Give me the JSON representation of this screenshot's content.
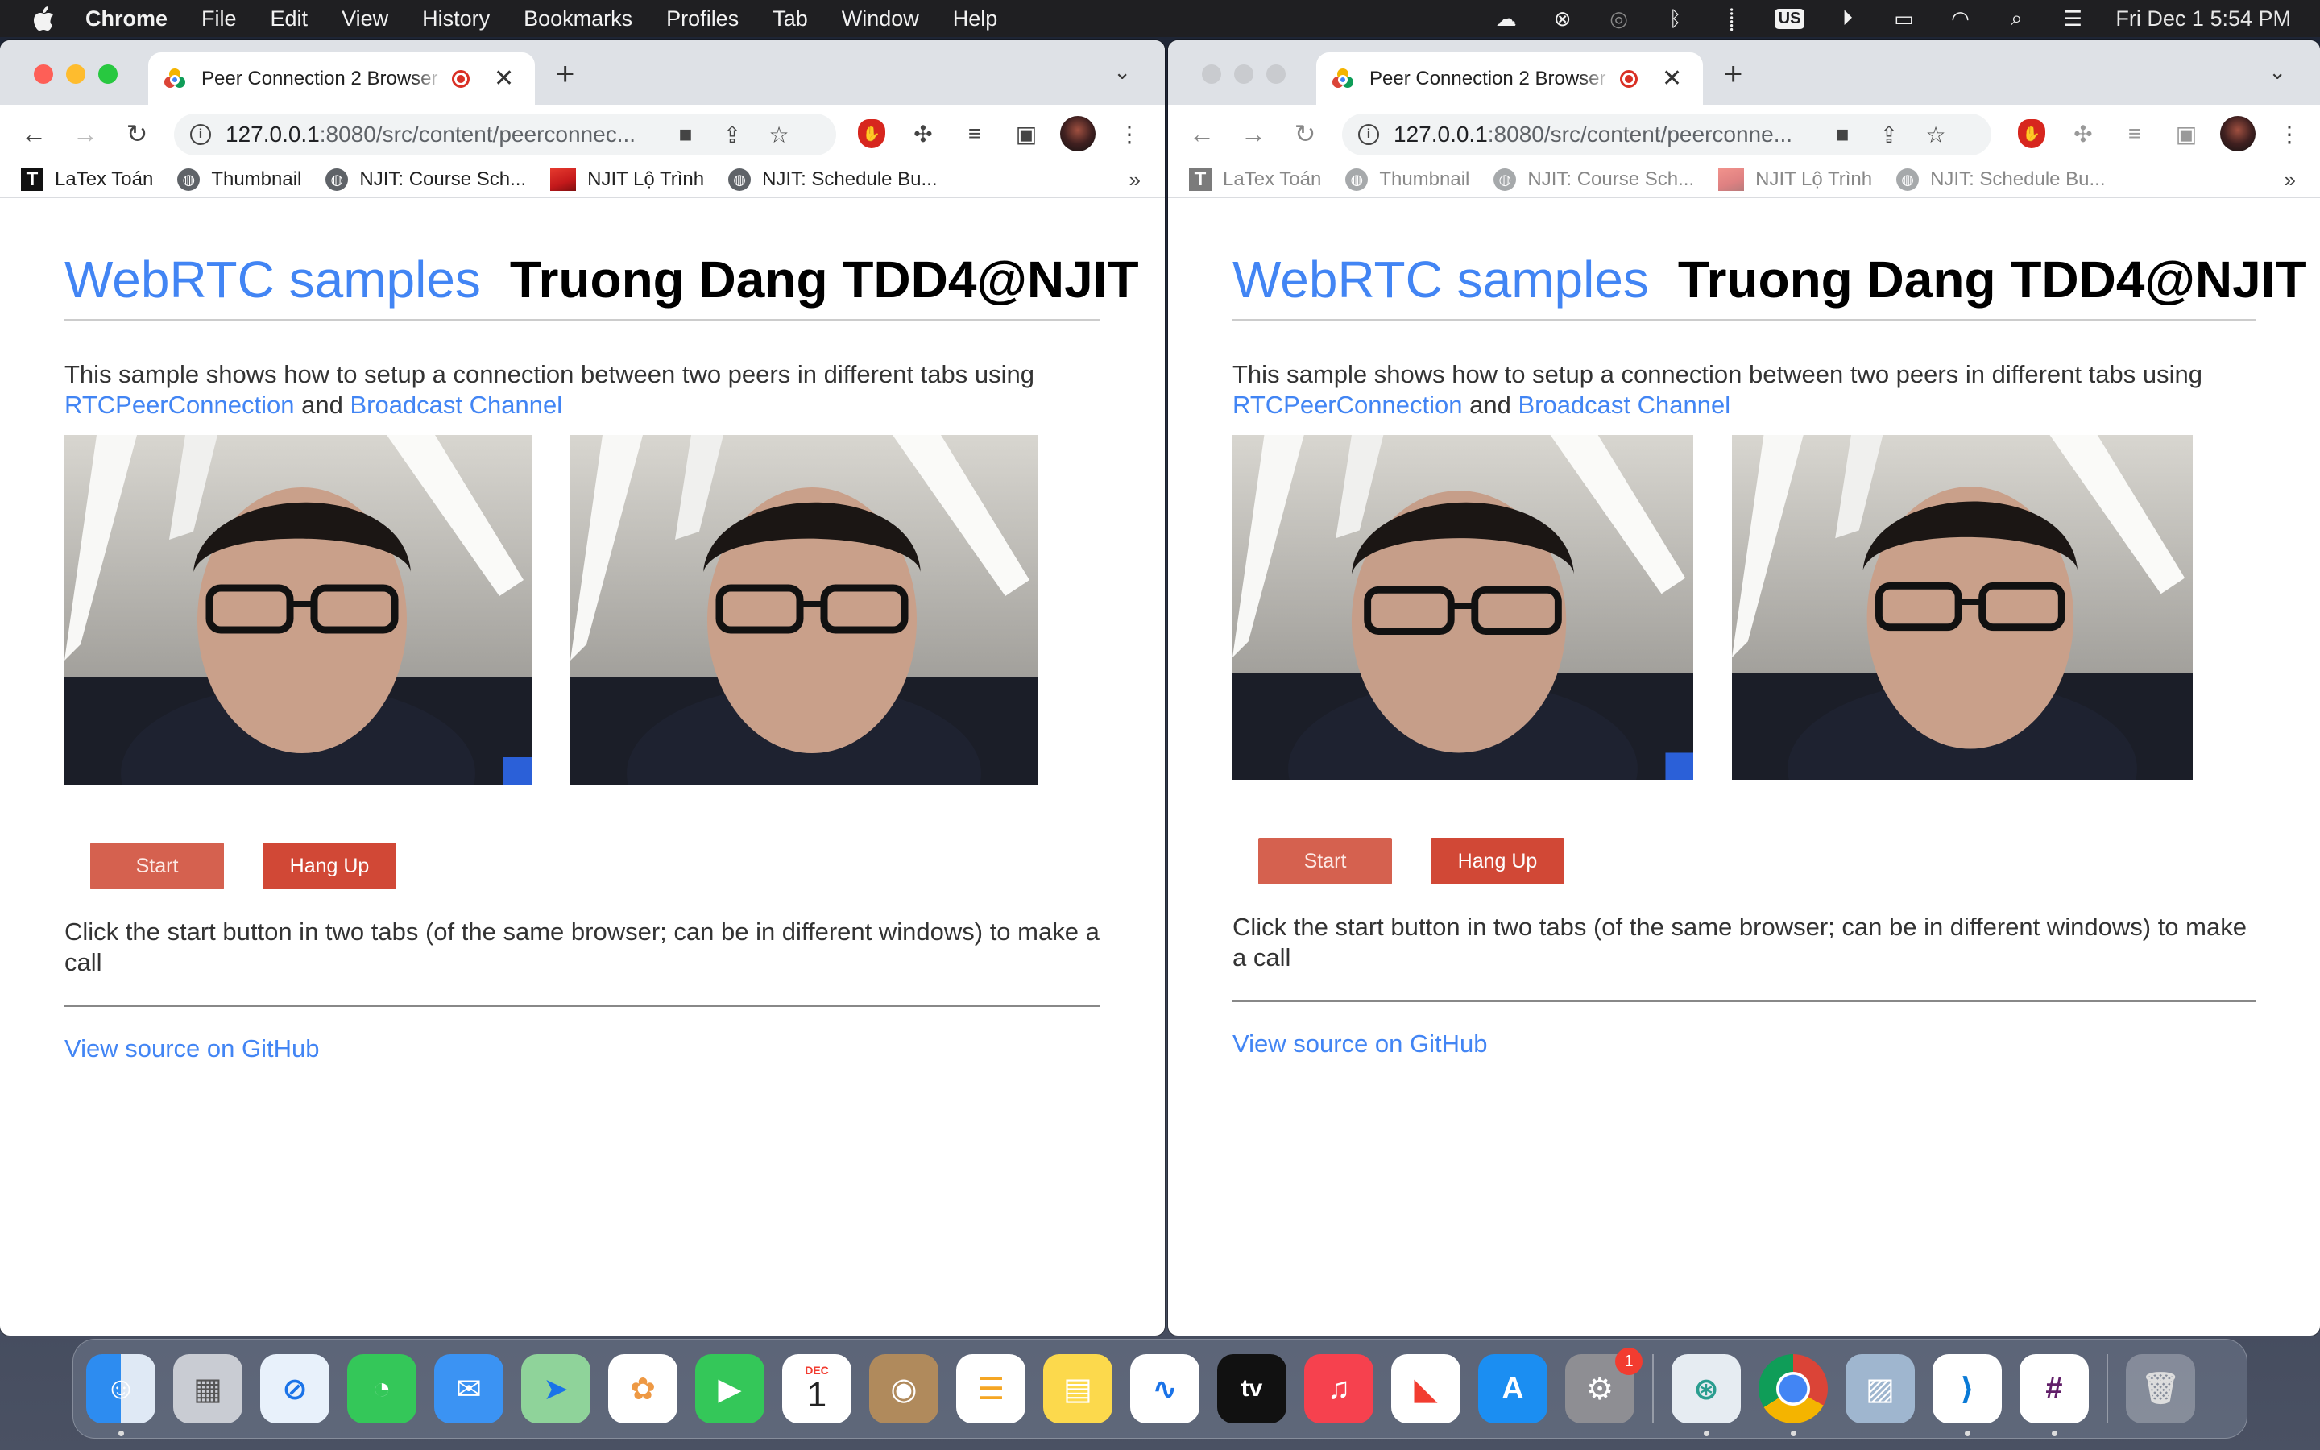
{
  "menubar": {
    "app_name": "Chrome",
    "menus": [
      "File",
      "Edit",
      "View",
      "History",
      "Bookmarks",
      "Profiles",
      "Tab",
      "Window",
      "Help"
    ],
    "status_icons": [
      "creative-cloud-icon",
      "screen-share-icon",
      "airdrop-icon",
      "bluetooth-icon",
      "airpods-icon"
    ],
    "input_source": "US",
    "clock": "Fri Dec 1  5:54 PM"
  },
  "windows": [
    {
      "tab_title": "Peer Connection 2 Browser",
      "url_host": "127.0.0.1",
      "url_rest": ":8080/src/content/peerconnec...",
      "bookmarks": [
        "LaTex Toán",
        "Thumbnail",
        "NJIT: Course Sch...",
        "NJIT Lộ Trình",
        "NJIT: Schedule Bu..."
      ],
      "page": {
        "title_link": "WebRTC samples",
        "title_author": "Truong Dang TDD4@NJIT",
        "description": "This sample shows how to setup a connection between two peers in different tabs using",
        "link1": "RTCPeerConnection",
        "and": "and",
        "link2": "Broadcast Channel",
        "start_label": "Start",
        "hangup_label": "Hang Up",
        "instructions": "Click the start button in two tabs (of the same browser; can be in different windows) to make a call",
        "source_link": "View source on GitHub"
      }
    },
    {
      "tab_title": "Peer Connection 2 Browser",
      "url_host": "127.0.0.1",
      "url_rest": ":8080/src/content/peerconne...",
      "bookmarks": [
        "LaTex Toán",
        "Thumbnail",
        "NJIT: Course Sch...",
        "NJIT Lộ Trình",
        "NJIT: Schedule Bu..."
      ],
      "page": {
        "title_link": "WebRTC samples",
        "title_author": "Truong Dang TDD4@NJIT",
        "description": "This sample shows how to setup a connection between two peers in different tabs using",
        "link1": "RTCPeerConnection",
        "and": "and",
        "link2": "Broadcast Channel",
        "start_label": "Start",
        "hangup_label": "Hang Up",
        "instructions": "Click the start button in two tabs (of the same browser; can be in different windows) to make a call",
        "source_link": "View source on GitHub"
      }
    }
  ],
  "dock": {
    "apps": [
      "finder",
      "launchpad",
      "safari",
      "messages",
      "mail",
      "maps",
      "photos",
      "facetime",
      "calendar",
      "contacts",
      "reminders",
      "notes",
      "freeform",
      "tv",
      "music",
      "news",
      "app-store",
      "system-settings"
    ],
    "apps2": [
      "network-app",
      "chrome",
      "preview",
      "vscode",
      "slack"
    ],
    "calendar_month": "DEC",
    "calendar_day": "1",
    "tv_label": "tv",
    "settings_badge": "1"
  },
  "colors": {
    "accent": "#4285f4",
    "button": "#d14836"
  }
}
